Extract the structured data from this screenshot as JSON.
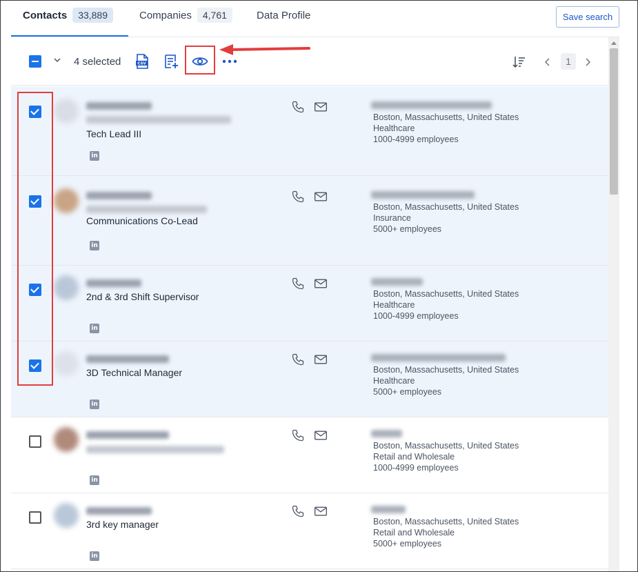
{
  "tabs": [
    {
      "label": "Contacts",
      "count": "33,889"
    },
    {
      "label": "Companies",
      "count": "4,761"
    },
    {
      "label": "Data Profile"
    }
  ],
  "save_search_label": "Save search",
  "toolbar": {
    "selected_text": "4 selected",
    "icons": [
      "csv-export-icon",
      "add-to-list-icon",
      "eye-icon",
      "more-icon",
      "sort-icon"
    ],
    "page_number": "1"
  },
  "colors": {
    "accent": "#1a73e8",
    "highlight": "#e23d3d",
    "selected_row": "#eef4fc"
  },
  "contacts": [
    {
      "selected": true,
      "title": "Tech Lead III",
      "location": "Boston, Massachusetts, United States",
      "industry": "Healthcare",
      "employees": "1000-4999 employees"
    },
    {
      "selected": true,
      "title": "Communications Co-Lead",
      "location": "Boston, Massachusetts, United States",
      "industry": "Insurance",
      "employees": "5000+ employees"
    },
    {
      "selected": true,
      "title": "2nd & 3rd Shift Supervisor",
      "location": "Boston, Massachusetts, United States",
      "industry": "Healthcare",
      "employees": "1000-4999 employees"
    },
    {
      "selected": true,
      "title": "3D Technical Manager",
      "location": "Boston, Massachusetts, United States",
      "industry": "Healthcare",
      "employees": "5000+ employees"
    },
    {
      "selected": false,
      "title": "",
      "location": "Boston, Massachusetts, United States",
      "industry": "Retail and Wholesale",
      "employees": "1000-4999 employees"
    },
    {
      "selected": false,
      "title": "3rd key manager",
      "location": "Boston, Massachusetts, United States",
      "industry": "Retail and Wholesale",
      "employees": "5000+ employees"
    }
  ]
}
